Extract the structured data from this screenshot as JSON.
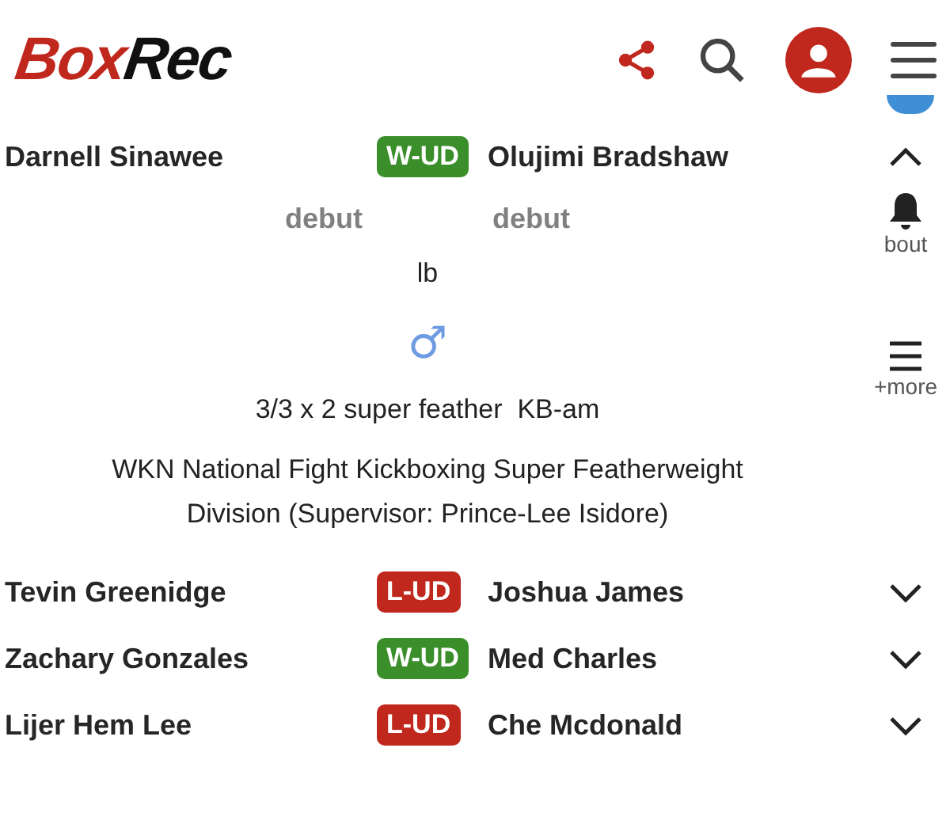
{
  "header": {
    "logo": [
      {
        "text": "Box",
        "color": "#c0281e"
      },
      {
        "text": "Rec",
        "color": "#111111"
      }
    ]
  },
  "bouts": [
    {
      "fighter": "Darnell Sinawee",
      "result": {
        "text": "W-UD",
        "kind": "win"
      },
      "opponent": "Olujimi Bradshaw",
      "expanded": true,
      "details": {
        "fighter_record": "debut",
        "opponent_record": "debut",
        "weight": "lb",
        "gender_symbol": "♂",
        "rounds": "3/3 x 2 super feather  KB-am",
        "title": "WKN National Fight Kickboxing Super Featherweight Division (Supervisor: Prince-Lee Isidore)"
      },
      "actions": [
        {
          "kind": "bell",
          "label": "bout"
        },
        {
          "kind": "menu",
          "label": "+more"
        }
      ]
    },
    {
      "fighter": "Tevin Greenidge",
      "result": {
        "text": "L-UD",
        "kind": "loss"
      },
      "opponent": "Joshua James",
      "expanded": false
    },
    {
      "fighter": "Zachary Gonzales",
      "result": {
        "text": "W-UD",
        "kind": "win"
      },
      "opponent": "Med Charles",
      "expanded": false
    },
    {
      "fighter": "Lijer Hem Lee",
      "result": {
        "text": "L-UD",
        "kind": "loss"
      },
      "opponent": "Che Mcdonald",
      "expanded": false
    }
  ]
}
